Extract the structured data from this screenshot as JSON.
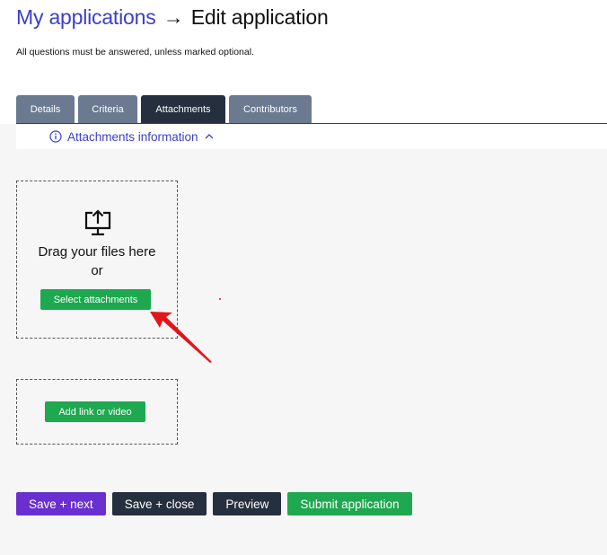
{
  "header": {
    "breadcrumb_link": "My applications",
    "arrow": "→",
    "page_title": "Edit application",
    "subtitle": "All questions must be answered, unless marked optional."
  },
  "tabs": [
    {
      "label": "Details",
      "active": false
    },
    {
      "label": "Criteria",
      "active": false
    },
    {
      "label": "Attachments",
      "active": true
    },
    {
      "label": "Contributors",
      "active": false
    }
  ],
  "info": {
    "label": "Attachments information",
    "icon": "info-icon",
    "toggle_icon": "chevron-up-icon"
  },
  "upload": {
    "icon": "upload-icon",
    "drag_text": "Drag your files here",
    "or_text": "or",
    "button_label": "Select attachments"
  },
  "link": {
    "button_label": "Add link or video"
  },
  "actions": {
    "save_next": "Save + next",
    "save_close": "Save + close",
    "preview": "Preview",
    "submit": "Submit application"
  },
  "colors": {
    "link_blue": "#3b3fc8",
    "tab_inactive": "#6b7a90",
    "tab_active": "#262f3e",
    "green": "#1ea84f",
    "purple": "#6a2fd0",
    "annotation_red": "#e3141b"
  }
}
